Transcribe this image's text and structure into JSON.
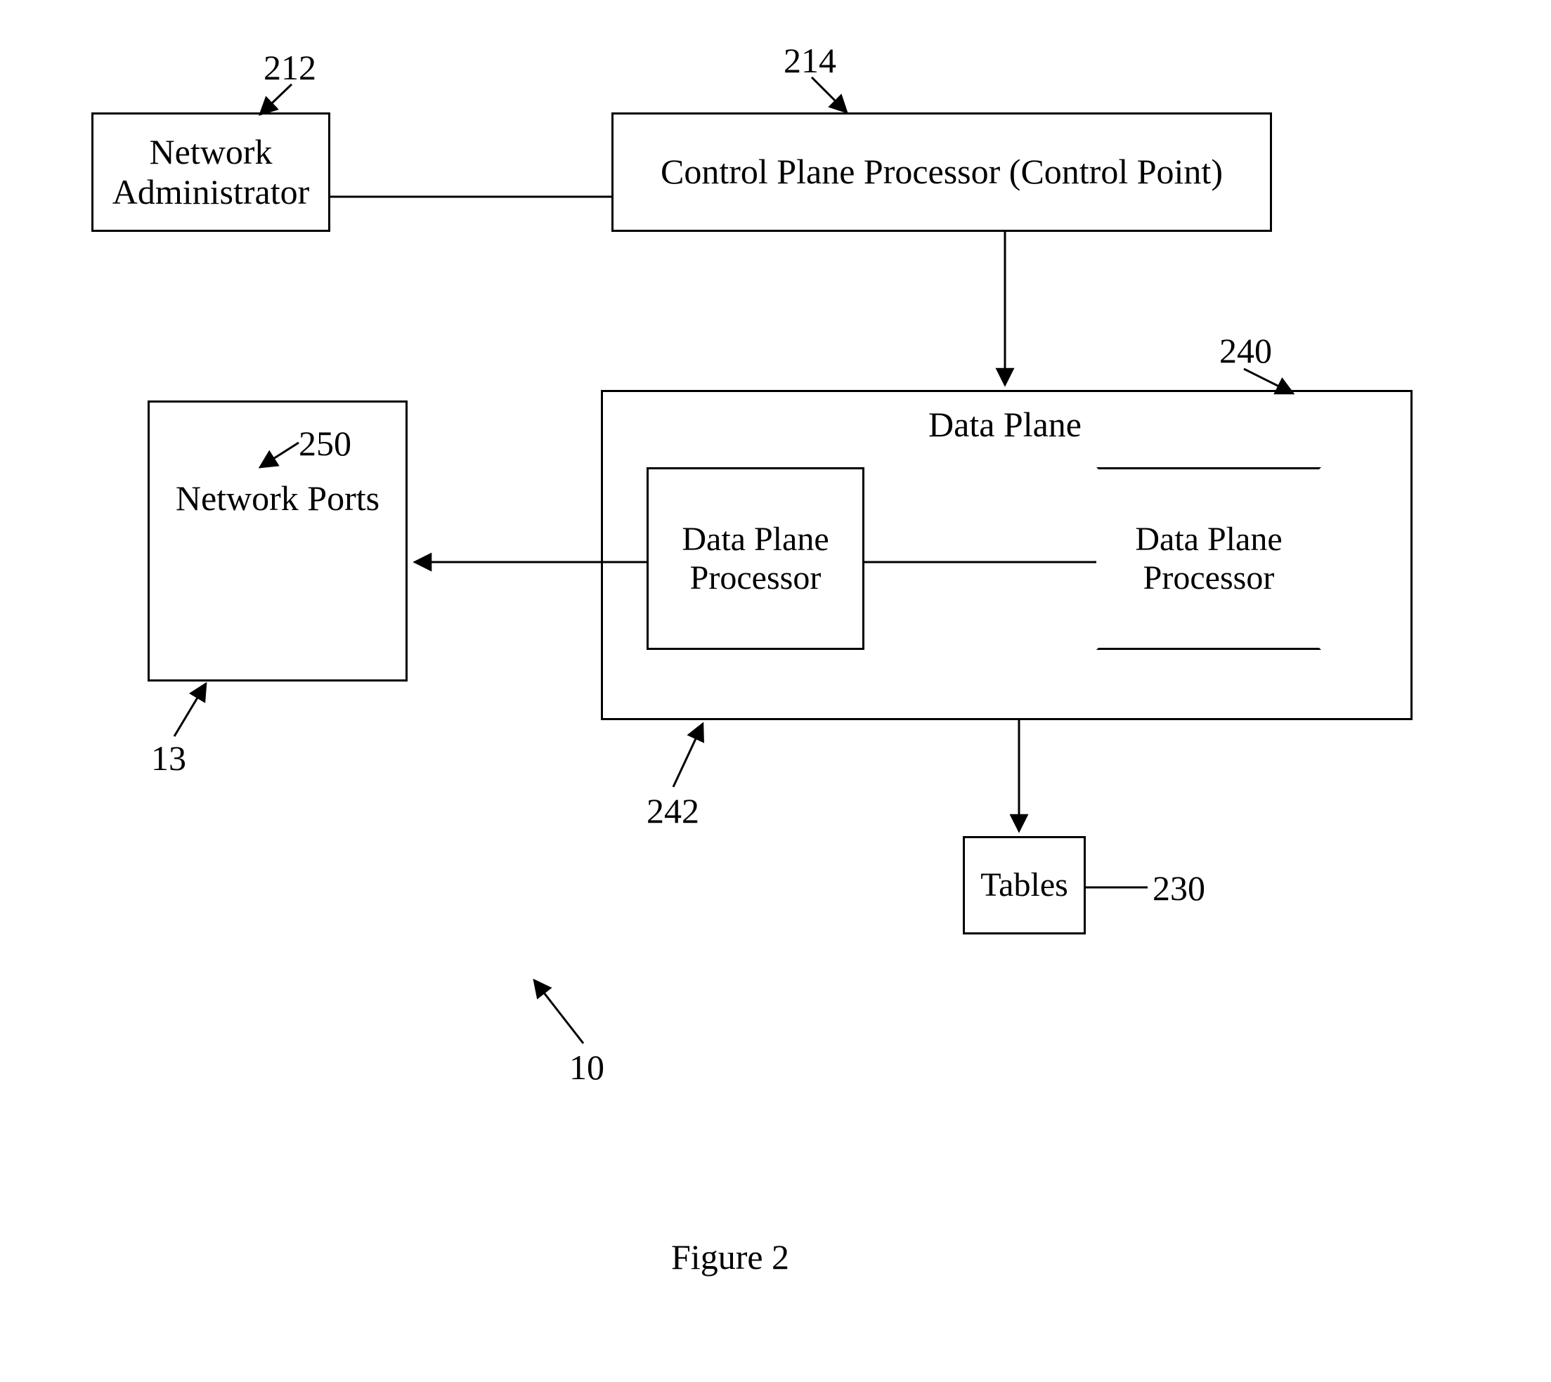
{
  "figure_label": "Figure 2",
  "refs": {
    "network_admin": "212",
    "control_plane": "214",
    "data_plane": "240",
    "network_ports_container": "13",
    "network_ports_inner": "250",
    "data_plane_processor": "242",
    "tables": "230",
    "whole": "10"
  },
  "boxes": {
    "network_admin": "Network\nAdministrator",
    "control_plane": "Control Plane Processor\n(Control Point)",
    "data_plane_title": "Data Plane",
    "network_ports": "Network Ports",
    "dpp_left": "Data\nPlane\nProcessor",
    "dpp_right": "Data\nPlane\nProcessor",
    "tables": "Tables"
  }
}
